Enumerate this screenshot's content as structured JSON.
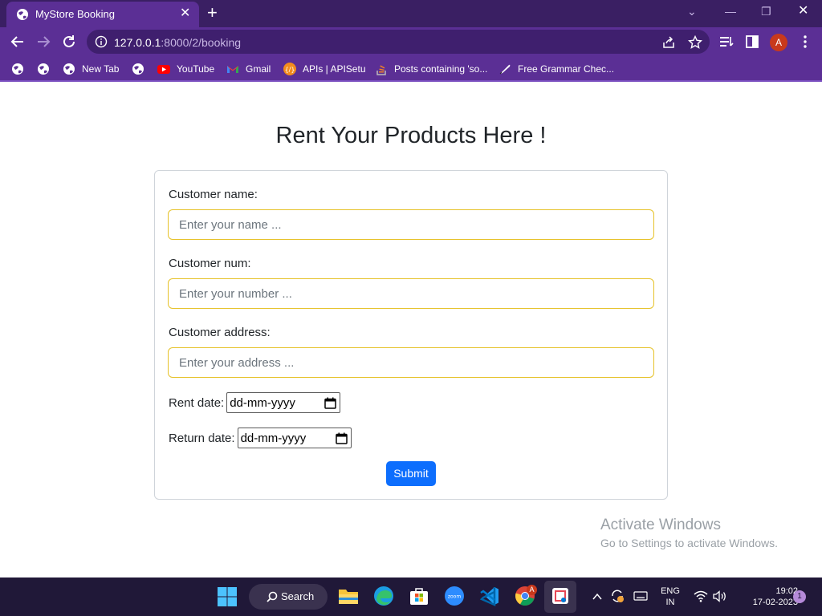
{
  "browser": {
    "tab_title": "MyStore Booking",
    "url_host": "127.0.0.1",
    "url_path": ":8000/2/booking",
    "bookmarks": [
      {
        "label": "",
        "icon": "globe-icon"
      },
      {
        "label": "",
        "icon": "globe-icon"
      },
      {
        "label": "New Tab",
        "icon": "globe-icon"
      },
      {
        "label": "",
        "icon": "globe-icon"
      },
      {
        "label": "YouTube",
        "icon": "youtube-icon"
      },
      {
        "label": "Gmail",
        "icon": "gmail-icon"
      },
      {
        "label": "APIs | APISetu",
        "icon": "apisetu-icon"
      },
      {
        "label": "Posts containing 'so...",
        "icon": "stackoverflow-icon"
      },
      {
        "label": "Free Grammar Chec...",
        "icon": "quill-icon"
      }
    ],
    "profile_initial": "A",
    "colors": {
      "frame": "#3a1f63",
      "toolbar": "#5b2f95"
    }
  },
  "page": {
    "title": "Rent Your Products Here !",
    "form": {
      "name_label": "Customer name:",
      "name_placeholder": "Enter your name ...",
      "num_label": "Customer num:",
      "num_placeholder": "Enter your number ...",
      "address_label": "Customer address:",
      "address_placeholder": "Enter your address ...",
      "rent_date_label": "Rent date:",
      "rent_date_value": "dd-mm-yyyy",
      "return_date_label": "Return date:",
      "return_date_value": "dd-mm-yyyy",
      "submit_label": "Submit"
    },
    "colors": {
      "input_border": "#e6c229",
      "submit": "#0d6efd"
    }
  },
  "watermark": {
    "line1": "Activate Windows",
    "line2": "Go to Settings to activate Windows."
  },
  "taskbar": {
    "search_label": "Search",
    "lang_line1": "ENG",
    "lang_line2": "IN",
    "time": "19:02",
    "date": "17-02-2023",
    "notification_count": "1",
    "chrome_badge": "A"
  }
}
